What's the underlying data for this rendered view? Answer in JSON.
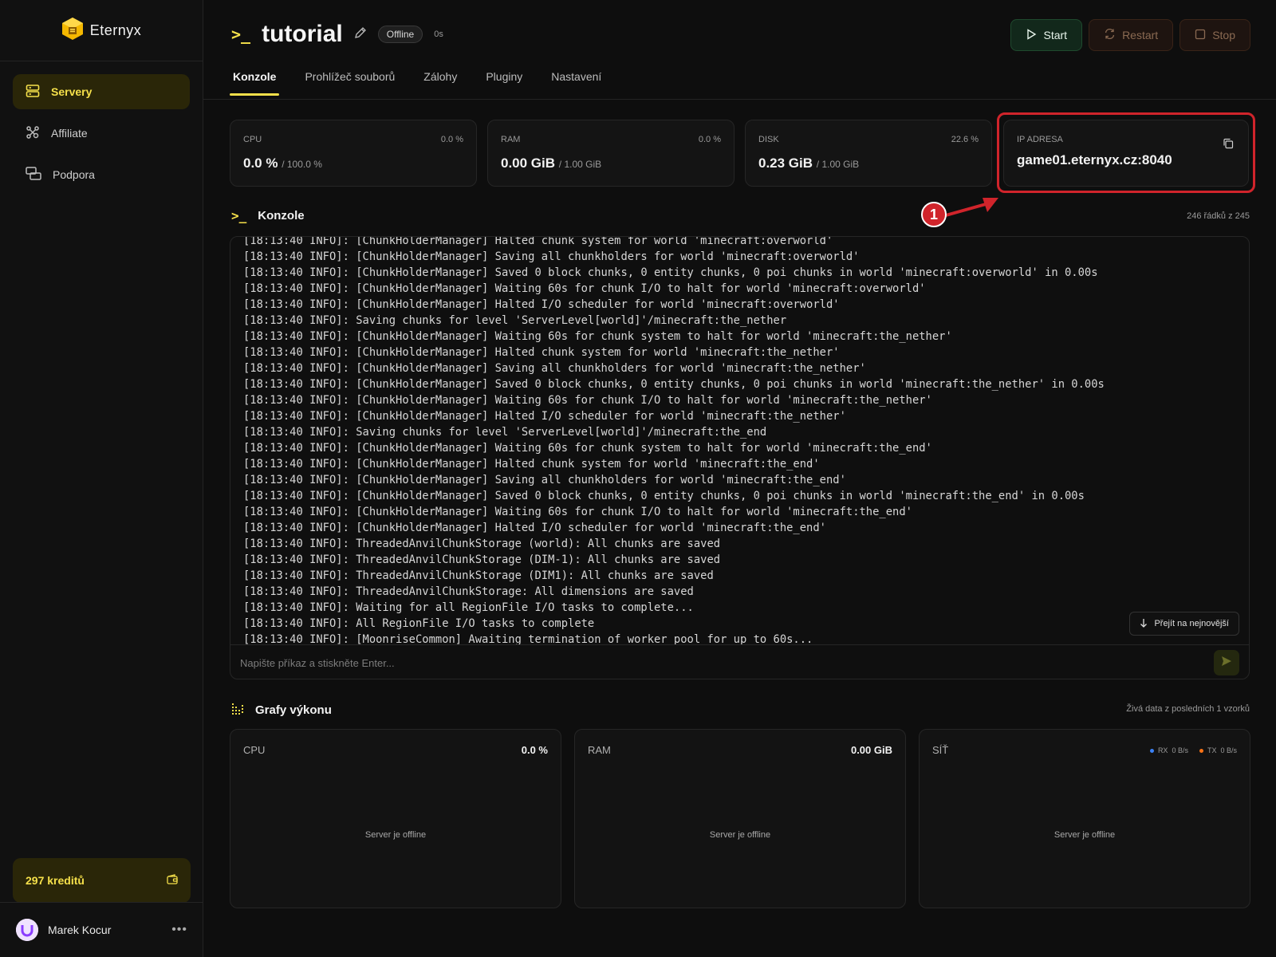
{
  "brand": {
    "name": "Eternyx"
  },
  "sidebar": {
    "items": [
      {
        "label": "Servery",
        "icon": "server-icon",
        "active": true
      },
      {
        "label": "Affiliate",
        "icon": "share-nodes-icon",
        "active": false
      },
      {
        "label": "Podpora",
        "icon": "chat-bubbles-icon",
        "active": false
      }
    ],
    "credits": "297 kreditů",
    "user": {
      "name": "Marek Kocur"
    }
  },
  "header": {
    "title": "tutorial",
    "status": "Offline",
    "uptime": "0s",
    "actions": {
      "start": "Start",
      "restart": "Restart",
      "stop": "Stop"
    },
    "tabs": [
      "Konzole",
      "Prohlížeč souborů",
      "Zálohy",
      "Pluginy",
      "Nastavení"
    ]
  },
  "stats": {
    "cpu": {
      "label": "CPU",
      "percent": "0.0 %",
      "value": "0.0 %",
      "max": "/ 100.0 %"
    },
    "ram": {
      "label": "RAM",
      "percent": "0.0 %",
      "value": "0.00 GiB",
      "max": "/ 1.00 GiB"
    },
    "disk": {
      "label": "DISK",
      "percent": "22.6 %",
      "value": "0.23 GiB",
      "max": "/ 1.00 GiB"
    },
    "ip": {
      "label": "IP ADRESA",
      "value": "game01.eternyx.cz:8040"
    }
  },
  "annotation": {
    "marker": "1",
    "color": "#d0242b"
  },
  "console": {
    "title": "Konzole",
    "line_count": "246 řádků z 245",
    "lines": [
      "[18:13:40 INFO]: [ChunkHolderManager] Halted chunk system for world 'minecraft:overworld'",
      "[18:13:40 INFO]: [ChunkHolderManager] Saving all chunkholders for world 'minecraft:overworld'",
      "[18:13:40 INFO]: [ChunkHolderManager] Saved 0 block chunks, 0 entity chunks, 0 poi chunks in world 'minecraft:overworld' in 0.00s",
      "[18:13:40 INFO]: [ChunkHolderManager] Waiting 60s for chunk I/O to halt for world 'minecraft:overworld'",
      "[18:13:40 INFO]: [ChunkHolderManager] Halted I/O scheduler for world 'minecraft:overworld'",
      "[18:13:40 INFO]: Saving chunks for level 'ServerLevel[world]'/minecraft:the_nether",
      "[18:13:40 INFO]: [ChunkHolderManager] Waiting 60s for chunk system to halt for world 'minecraft:the_nether'",
      "[18:13:40 INFO]: [ChunkHolderManager] Halted chunk system for world 'minecraft:the_nether'",
      "[18:13:40 INFO]: [ChunkHolderManager] Saving all chunkholders for world 'minecraft:the_nether'",
      "[18:13:40 INFO]: [ChunkHolderManager] Saved 0 block chunks, 0 entity chunks, 0 poi chunks in world 'minecraft:the_nether' in 0.00s",
      "[18:13:40 INFO]: [ChunkHolderManager] Waiting 60s for chunk I/O to halt for world 'minecraft:the_nether'",
      "[18:13:40 INFO]: [ChunkHolderManager] Halted I/O scheduler for world 'minecraft:the_nether'",
      "[18:13:40 INFO]: Saving chunks for level 'ServerLevel[world]'/minecraft:the_end",
      "[18:13:40 INFO]: [ChunkHolderManager] Waiting 60s for chunk system to halt for world 'minecraft:the_end'",
      "[18:13:40 INFO]: [ChunkHolderManager] Halted chunk system for world 'minecraft:the_end'",
      "[18:13:40 INFO]: [ChunkHolderManager] Saving all chunkholders for world 'minecraft:the_end'",
      "[18:13:40 INFO]: [ChunkHolderManager] Saved 0 block chunks, 0 entity chunks, 0 poi chunks in world 'minecraft:the_end' in 0.00s",
      "[18:13:40 INFO]: [ChunkHolderManager] Waiting 60s for chunk I/O to halt for world 'minecraft:the_end'",
      "[18:13:40 INFO]: [ChunkHolderManager] Halted I/O scheduler for world 'minecraft:the_end'",
      "[18:13:40 INFO]: ThreadedAnvilChunkStorage (world): All chunks are saved",
      "[18:13:40 INFO]: ThreadedAnvilChunkStorage (DIM-1): All chunks are saved",
      "[18:13:40 INFO]: ThreadedAnvilChunkStorage (DIM1): All chunks are saved",
      "[18:13:40 INFO]: ThreadedAnvilChunkStorage: All dimensions are saved",
      "[18:13:40 INFO]: Waiting for all RegionFile I/O tasks to complete...",
      "[18:13:40 INFO]: All RegionFile I/O tasks to complete",
      "[18:13:40 INFO]: [MoonriseCommon] Awaiting termination of worker pool for up to 60s..."
    ],
    "jump_label": "Přejít na nejnovější",
    "input_placeholder": "Napište příkaz a stiskněte Enter..."
  },
  "graphs": {
    "title": "Grafy výkonu",
    "meta": "Živá data z posledních 1 vzorků",
    "cpu": {
      "label": "CPU",
      "value": "0.0 %",
      "empty": "Server je offline"
    },
    "ram": {
      "label": "RAM",
      "value": "0.00 GiB",
      "empty": "Server je offline"
    },
    "net": {
      "label": "SÍŤ",
      "rx_label": "RX",
      "rx_value": "0 B/s",
      "rx_color": "#3b82f6",
      "tx_label": "TX",
      "tx_value": "0 B/s",
      "tx_color": "#f97316",
      "empty": "Server je offline"
    }
  },
  "colors": {
    "accent": "#f5e04a",
    "background": "#0e0e0e",
    "card": "#141414"
  }
}
